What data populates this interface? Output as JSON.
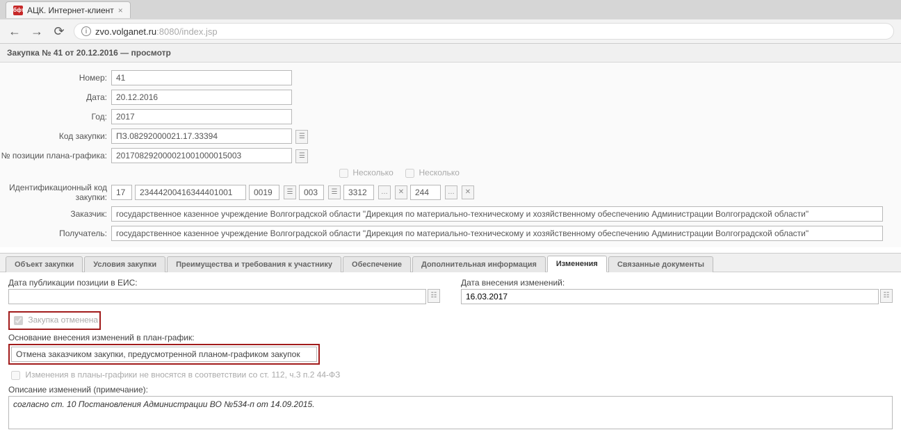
{
  "browser": {
    "tab_title": "АЦК. Интернет-клиент",
    "url_host": "zvo.volganet.ru",
    "url_port": ":8080",
    "url_path": "/index.jsp"
  },
  "page_title": "Закупка № 41 от 20.12.2016 — просмотр",
  "form": {
    "labels": {
      "number": "Номер:",
      "date": "Дата:",
      "year": "Год:",
      "purchase_code": "Код закупки:",
      "plan_position": "№ позиции плана-графика:",
      "ikz": "Идентификационный код закупки:",
      "customer": "Заказчик:",
      "recipient": "Получатель:"
    },
    "values": {
      "number": "41",
      "date": "20.12.2016",
      "year": "2017",
      "purchase_code": "ПЗ.08292000021.17.33394",
      "plan_position": "201708292000021001000015003",
      "customer": "государственное казенное учреждение Волгоградской области \"Дирекция по материально-техническому и хозяйственному обеспечению Администрации Волгоградской области\"",
      "recipient": "государственное казенное учреждение Волгоградской области \"Дирекция по материально-техническому и хозяйственному обеспечению Администрации Волгоградской области\""
    },
    "ikz": {
      "several1": "Несколько",
      "several2": "Несколько",
      "p1": "17",
      "p2": "23444200416344401001",
      "p3": "0019",
      "p4": "003",
      "p5": "3312",
      "p6": "244"
    }
  },
  "tabs": {
    "items": [
      "Объект закупки",
      "Условия закупки",
      "Преимущества и требования к участнику",
      "Обеспечение",
      "Дополнительная информация",
      "Изменения",
      "Связанные документы"
    ],
    "active_index": 5
  },
  "changes": {
    "eis_date_label": "Дата публикации позиции в ЕИС:",
    "eis_date_value": "",
    "change_date_label": "Дата внесения изменений:",
    "change_date_value": "16.03.2017",
    "cancelled_label": "Закупка отменена",
    "basis_label": "Основание внесения изменений в план-график:",
    "basis_value": "Отмена заказчиком закупки, предусмотренной планом-графиком закупок",
    "no_changes_label": "Изменения в планы-графики не вносятся в соответствии со ст. 112, ч.3 п.2 44-ФЗ",
    "note_label": "Описание изменений (примечание):",
    "note_value": "согласно ст. 10 Постановления Администрации ВО №534-п от 14.09.2015."
  }
}
